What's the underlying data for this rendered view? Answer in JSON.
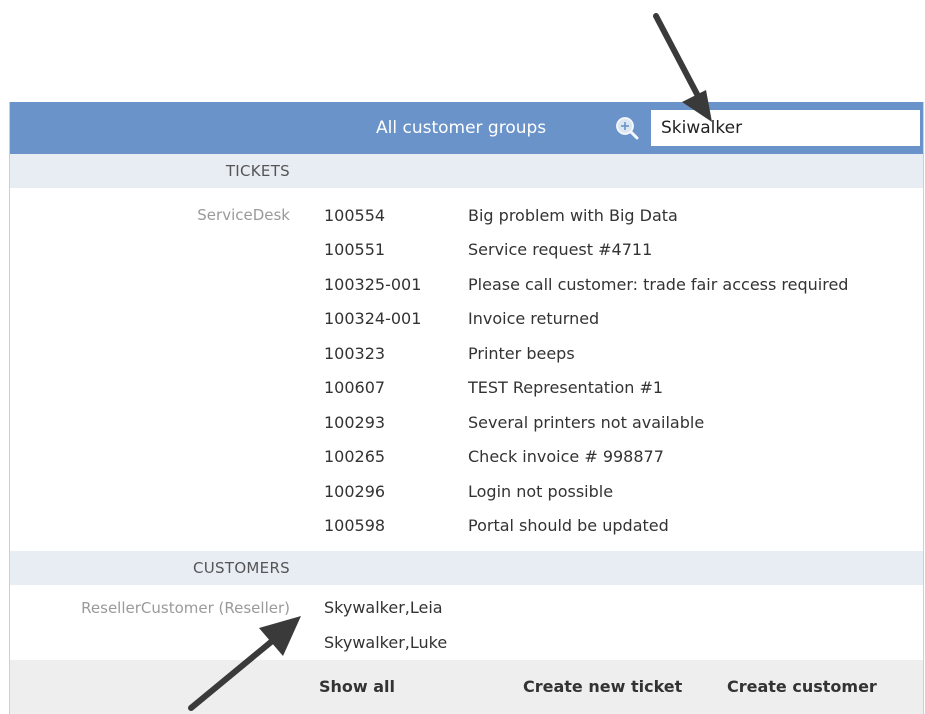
{
  "header": {
    "title": "All customer groups",
    "search_value": "Skiwalker"
  },
  "tickets": {
    "section_label": "TICKETS",
    "group_label": "ServiceDesk",
    "rows": [
      {
        "id": "100554",
        "subject": "Big problem with Big Data"
      },
      {
        "id": "100551",
        "subject": "Service request #4711"
      },
      {
        "id": "100325-001",
        "subject": "Please call customer: trade fair access required"
      },
      {
        "id": "100324-001",
        "subject": "Invoice returned"
      },
      {
        "id": "100323",
        "subject": "Printer beeps"
      },
      {
        "id": "100607",
        "subject": "TEST Representation #1"
      },
      {
        "id": "100293",
        "subject": "Several printers not available"
      },
      {
        "id": "100265",
        "subject": "Check invoice # 998877"
      },
      {
        "id": "100296",
        "subject": "Login not possible"
      },
      {
        "id": "100598",
        "subject": "Portal should be updated"
      }
    ]
  },
  "customers": {
    "section_label": "CUSTOMERS",
    "group_label": "ResellerCustomer (Reseller)",
    "rows": [
      {
        "name": "Skywalker,Leia"
      },
      {
        "name": "Skywalker,Luke"
      }
    ]
  },
  "footer": {
    "show_all": "Show all",
    "create_ticket": "Create new ticket",
    "create_customer": "Create customer"
  },
  "colors": {
    "header_bg": "#6a93c9",
    "section_bg": "#e8edf4",
    "footer_bg": "#eeeeee",
    "arrow": "#3a3a3a"
  },
  "icons": {
    "search": "zoom-in-magnifier-icon",
    "annotation": "arrow-icon"
  }
}
